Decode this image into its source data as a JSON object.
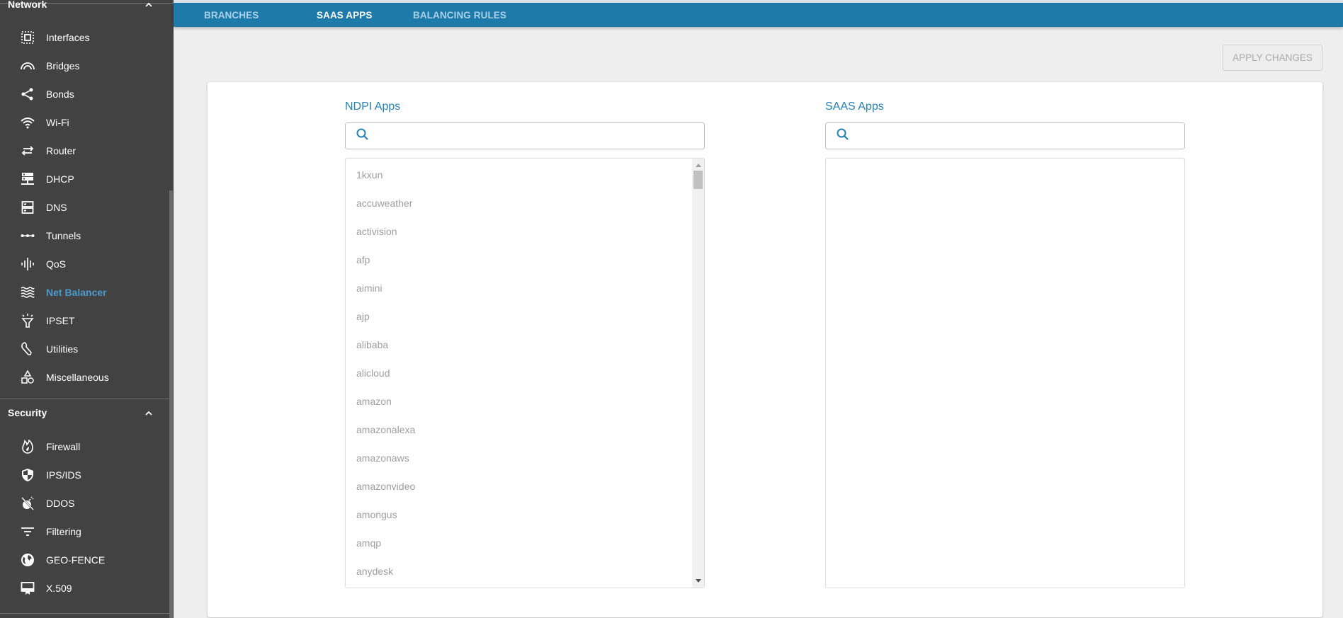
{
  "sidebar": {
    "network_group": {
      "label": "Network",
      "expanded": true,
      "items": [
        {
          "label": "Interfaces",
          "icon": "interfaces-icon"
        },
        {
          "label": "Bridges",
          "icon": "bridges-icon"
        },
        {
          "label": "Bonds",
          "icon": "share-icon"
        },
        {
          "label": "Wi-Fi",
          "icon": "wifi-icon"
        },
        {
          "label": "Router",
          "icon": "swap-arrows-icon"
        },
        {
          "label": "DHCP",
          "icon": "dhcp-server-icon"
        },
        {
          "label": "DNS",
          "icon": "dns-server-icon"
        },
        {
          "label": "Tunnels",
          "icon": "tunnel-dots-icon"
        },
        {
          "label": "QoS",
          "icon": "waveform-icon"
        },
        {
          "label": "Net Balancer",
          "icon": "waves-icon",
          "active": true
        },
        {
          "label": "IPSET",
          "icon": "funnel-light-icon"
        },
        {
          "label": "Utilities",
          "icon": "wrench-icon"
        },
        {
          "label": "Miscellaneous",
          "icon": "shapes-icon"
        }
      ]
    },
    "security_group": {
      "label": "Security",
      "expanded": true,
      "items": [
        {
          "label": "Firewall",
          "icon": "fire-icon"
        },
        {
          "label": "IPS/IDS",
          "icon": "shield-icon"
        },
        {
          "label": "DDOS",
          "icon": "bomb-off-icon"
        },
        {
          "label": "Filtering",
          "icon": "filter-icon"
        },
        {
          "label": "GEO-FENCE",
          "icon": "globe-icon"
        },
        {
          "label": "X.509",
          "icon": "certificate-icon"
        }
      ]
    }
  },
  "topbar": {
    "tabs": [
      {
        "label": "BRANCHES",
        "active": false
      },
      {
        "label": "SAAS APPS",
        "active": true
      },
      {
        "label": "BALANCING RULES",
        "active": false
      }
    ]
  },
  "toolbar": {
    "apply_label": "APPLY CHANGES"
  },
  "ndpi": {
    "title": "NDPI Apps",
    "search_value": "",
    "search_placeholder": "",
    "items": [
      "1kxun",
      "accuweather",
      "activision",
      "afp",
      "aimini",
      "ajp",
      "alibaba",
      "alicloud",
      "amazon",
      "amazonalexa",
      "amazonaws",
      "amazonvideo",
      "amongus",
      "amqp",
      "anydesk"
    ]
  },
  "saas": {
    "title": "SAAS Apps",
    "search_value": "",
    "search_placeholder": "",
    "items": []
  },
  "colors": {
    "accent": "#1e7ba9",
    "sidebar_bg": "#424242",
    "active_nav": "#4a9bc9",
    "title_blue": "#2582b4"
  }
}
